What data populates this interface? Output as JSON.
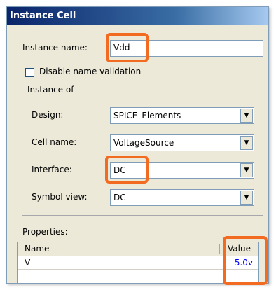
{
  "dialog": {
    "title": "Instance Cell"
  },
  "instance_name": {
    "label": "Instance name:",
    "value": "Vdd"
  },
  "disable_validation": {
    "label": "Disable name validation",
    "checked": false
  },
  "instance_of": {
    "legend": "Instance of",
    "design": {
      "label": "Design:",
      "value": "SPICE_Elements"
    },
    "cell_name": {
      "label": "Cell name:",
      "value": "VoltageSource"
    },
    "interface": {
      "label": "Interface:",
      "value": "DC"
    },
    "symbol_view": {
      "label": "Symbol view:",
      "value": "DC"
    }
  },
  "properties": {
    "label": "Properties:",
    "columns": [
      "Name",
      "Value"
    ],
    "rows": [
      {
        "name": "V",
        "value": "5.0v"
      }
    ]
  },
  "icons": {
    "dropdown": "▼"
  },
  "colors": {
    "highlight": "#f26b21",
    "value_text": "#0000ff",
    "title_bar": "#0a246a"
  }
}
